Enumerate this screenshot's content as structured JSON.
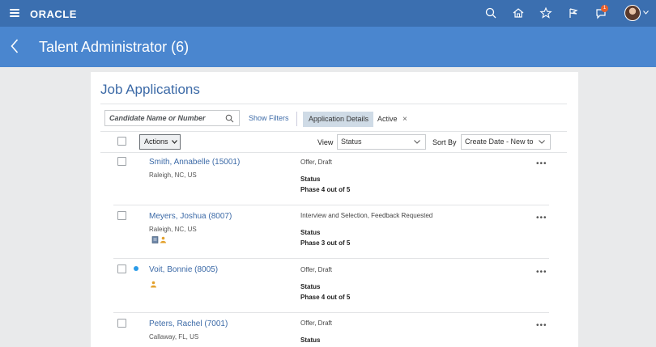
{
  "header": {
    "brand": "ORACLE",
    "notification_count": "1",
    "colors": {
      "topbar": "#3b6fb0",
      "titlebar": "#4a86cf"
    },
    "icons": [
      "search-icon",
      "home-icon",
      "star-icon",
      "flag-icon",
      "notifications-icon"
    ]
  },
  "titlebar": {
    "title": "Talent Administrator (6)"
  },
  "main": {
    "section_title": "Job Applications",
    "search_placeholder": "Candidate Name or Number",
    "show_filters": "Show Filters",
    "filter_chip": "Application Details",
    "filter_value": "Active",
    "actions_label": "Actions",
    "view_label": "View",
    "view_value": "Status",
    "sort_label": "Sort By",
    "sort_value": "Create Date - New to"
  },
  "applications": [
    {
      "name": "Smith, Annabelle (15001)",
      "location": "Raleigh, NC, US",
      "stage": "Offer, Draft",
      "status_label": "Status",
      "phase": "Phase 4 out of 5"
    },
    {
      "name": "Meyers, Joshua (8007)",
      "location": "Raleigh, NC, US",
      "stage": "Interview and Selection, Feedback Requested",
      "status_label": "Status",
      "phase": "Phase 3 out of 5"
    },
    {
      "name": "Voit, Bonnie (8005)",
      "location": "",
      "stage": "Offer, Draft",
      "status_label": "Status",
      "phase": "Phase 4 out of 5"
    },
    {
      "name": "Peters, Rachel (7001)",
      "location": "Callaway, FL, US",
      "stage": "Offer, Draft",
      "status_label": "Status",
      "phase": ""
    }
  ]
}
